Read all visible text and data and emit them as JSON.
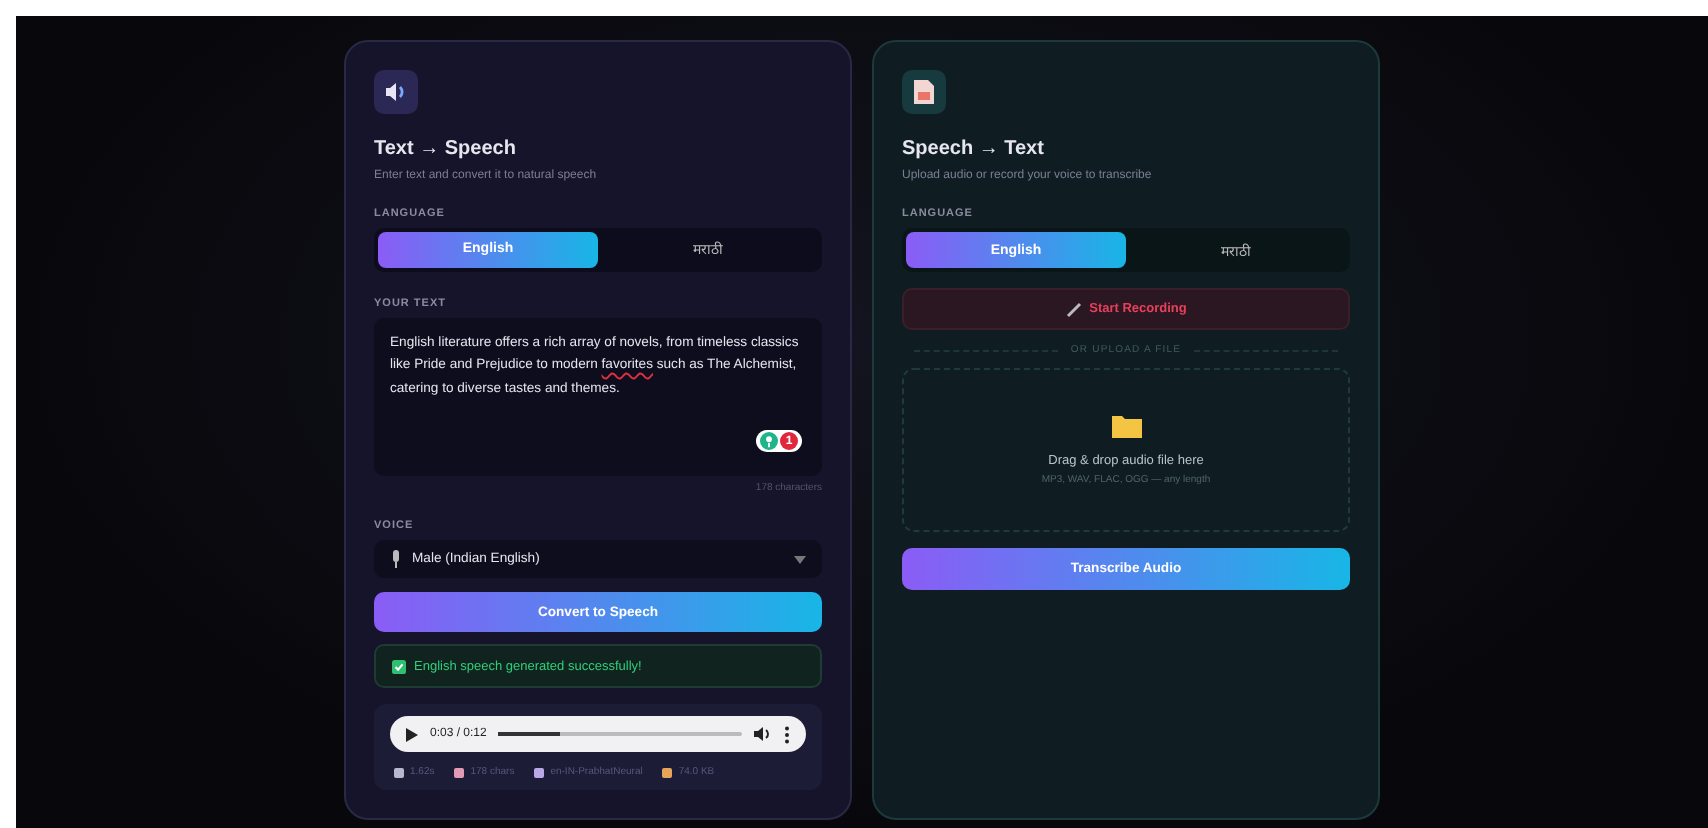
{
  "tts": {
    "title": "Text → Speech",
    "subtitle": "Enter text and convert it to natural speech",
    "language_label": "LANGUAGE",
    "languages": [
      {
        "label": "English",
        "selected": true
      },
      {
        "label": "मराठी",
        "selected": false
      }
    ],
    "text_label": "YOUR TEXT",
    "text": {
      "before": "English literature offers a rich array of novels, from timeless classics like Pride and Prejudice to modern ",
      "flagged": "favorites",
      "after": " such as The Alchemist, catering to diverse tastes and themes."
    },
    "issue_count": "1",
    "char_count": "178 characters",
    "voice_label": "VOICE",
    "voice": "Male (Indian English)",
    "convert_button": "Convert to Speech",
    "status": "English speech generated successfully!",
    "player": {
      "time": "0:03 / 0:12",
      "level": 0.25
    },
    "meta": [
      "1.62s",
      "178 chars",
      "en-IN-PrabhatNeural",
      "74.0 KB"
    ]
  },
  "stt": {
    "title": "Speech → Text",
    "subtitle": "Upload audio or record your voice to transcribe",
    "language_label": "LANGUAGE",
    "languages": [
      {
        "label": "English",
        "selected": true
      },
      {
        "label": "मराठी",
        "selected": false
      }
    ],
    "record_button": "Start Recording",
    "divider": "OR UPLOAD A FILE",
    "drop_title": "Drag & drop audio file here",
    "drop_hint": "MP3, WAV, FLAC, OGG — any length",
    "transcribe_button": "Transcribe Audio"
  }
}
